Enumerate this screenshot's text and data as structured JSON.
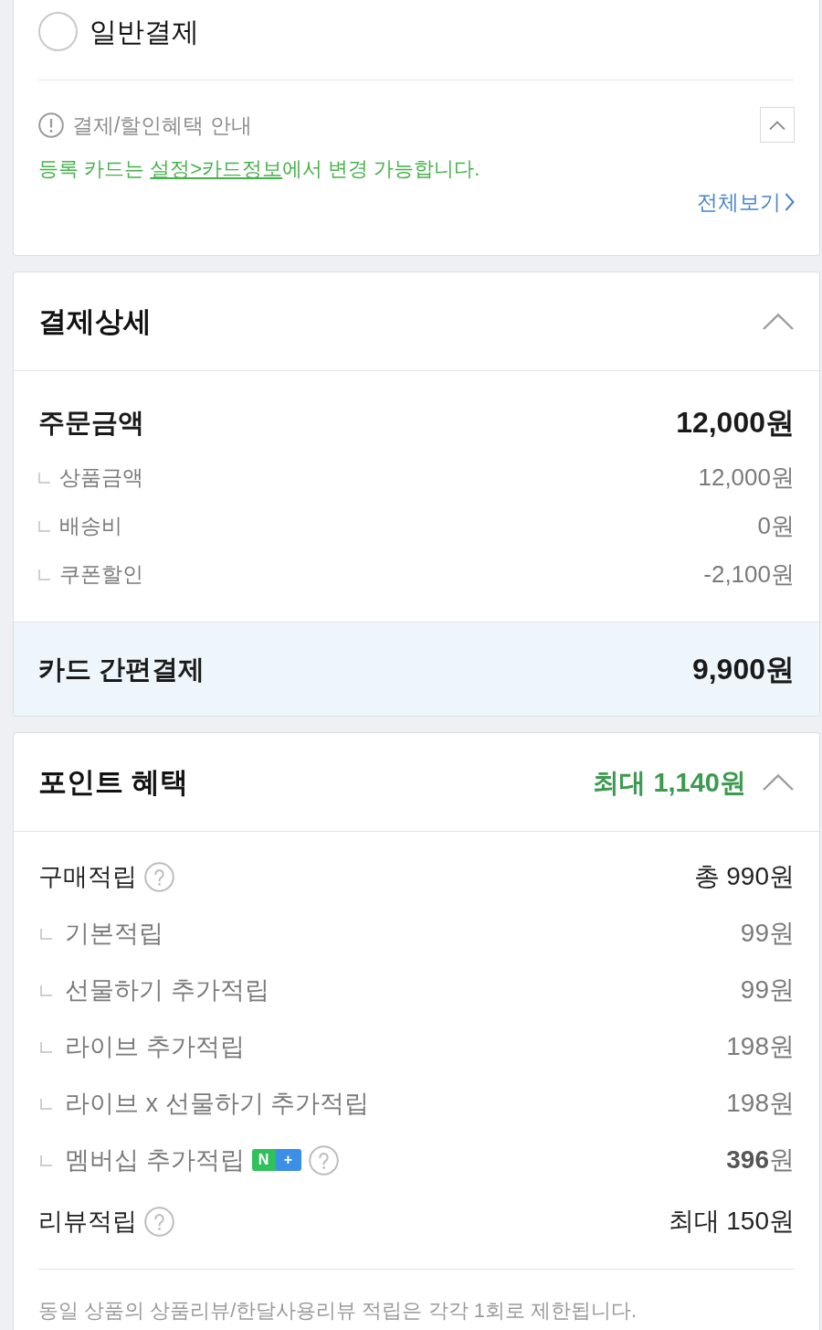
{
  "payment_option": {
    "label": "일반결제",
    "selected": false
  },
  "notice": {
    "title": "결제/할인혜택 안내",
    "expanded": true,
    "message_before": "등록 카드는 ",
    "link": "설정>카드정보",
    "message_after": "에서 변경 가능합니다.",
    "view_all": "전체보기"
  },
  "payment_detail": {
    "title": "결제상세",
    "expanded": true,
    "order_total": {
      "label": "주문금액",
      "value": "12,000원"
    },
    "items": [
      {
        "label": "상품금액",
        "value": "12,000원"
      },
      {
        "label": "배송비",
        "value": "0원"
      },
      {
        "label": "쿠폰할인",
        "value": "-2,100원"
      }
    ],
    "final": {
      "label": "카드 간편결제",
      "value": "9,900원"
    }
  },
  "point_benefit": {
    "title": "포인트 혜택",
    "summary": "최대 1,140원",
    "expanded": true,
    "groups": [
      {
        "label": "구매적립",
        "value": "총 990원",
        "help": true,
        "children": [
          {
            "label": "기본적립",
            "value": "99원"
          },
          {
            "label": "선물하기 추가적립",
            "value": "99원"
          },
          {
            "label": "라이브 추가적립",
            "value": "198원"
          },
          {
            "label": "라이브 x 선물하기 추가적립",
            "value": "198원"
          },
          {
            "label": "멤버십 추가적립",
            "value": "**396**원",
            "badge": [
              "N",
              "+"
            ],
            "help": true
          }
        ]
      },
      {
        "label": "리뷰적립",
        "value": "최대 150원",
        "help": true
      }
    ],
    "footnote": "동일 상품의 상품리뷰/한달사용리뷰 적립은 각각 1회로 제한됩니다."
  }
}
